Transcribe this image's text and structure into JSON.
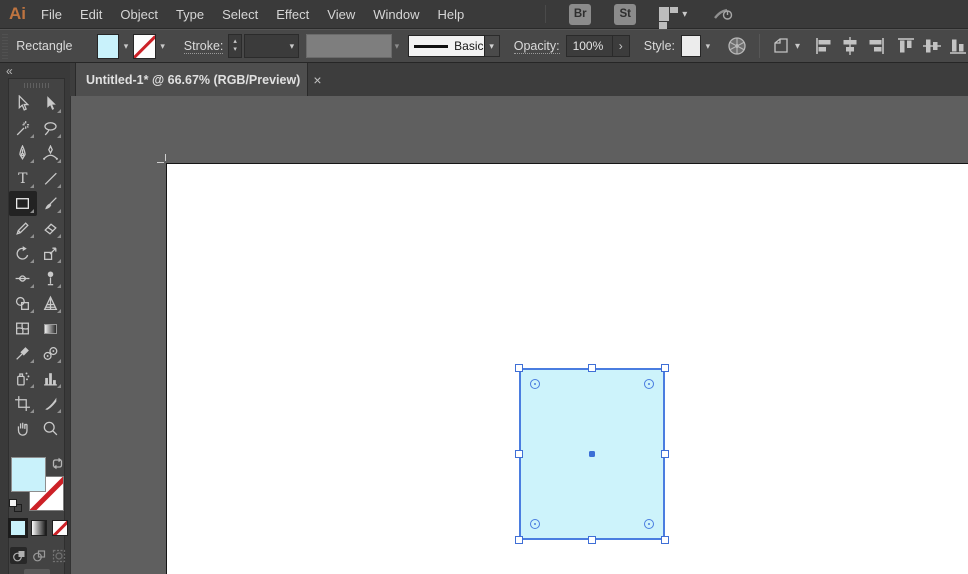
{
  "menu_bar": {
    "logo": "Ai",
    "items": [
      "File",
      "Edit",
      "Object",
      "Type",
      "Select",
      "Effect",
      "View",
      "Window",
      "Help"
    ],
    "bridge_button": "Br",
    "stock_button": "St"
  },
  "control_bar": {
    "context_label": "Rectangle",
    "stroke_label": "Stroke:",
    "brush_name": "Basic",
    "opacity_label": "Opacity:",
    "opacity_value": "100%",
    "style_label": "Style:"
  },
  "document_tab": {
    "title": "Untitled-1* @ 66.67% (RGB/Preview)",
    "close_label": "×"
  },
  "toolbar": {
    "collapse_label": "«",
    "tools": [
      {
        "name": "selection-tool"
      },
      {
        "name": "direct-selection-tool"
      },
      {
        "name": "magic-wand-tool"
      },
      {
        "name": "lasso-tool"
      },
      {
        "name": "pen-tool"
      },
      {
        "name": "curvature-tool"
      },
      {
        "name": "type-tool",
        "glyph": "T"
      },
      {
        "name": "line-segment-tool"
      },
      {
        "name": "rectangle-tool",
        "selected": true
      },
      {
        "name": "paintbrush-tool"
      },
      {
        "name": "pencil-tool"
      },
      {
        "name": "eraser-tool"
      },
      {
        "name": "rotate-tool"
      },
      {
        "name": "scale-tool"
      },
      {
        "name": "width-tool"
      },
      {
        "name": "puppet-warp-tool"
      },
      {
        "name": "shape-builder-tool"
      },
      {
        "name": "perspective-grid-tool"
      },
      {
        "name": "mesh-tool"
      },
      {
        "name": "gradient-tool"
      },
      {
        "name": "eyedropper-tool"
      },
      {
        "name": "blend-tool"
      },
      {
        "name": "symbol-sprayer-tool"
      },
      {
        "name": "column-graph-tool"
      },
      {
        "name": "artboard-tool"
      },
      {
        "name": "slice-tool"
      },
      {
        "name": "hand-tool"
      },
      {
        "name": "zoom-tool"
      }
    ],
    "fill_color": "#c9f2fb",
    "stroke_color": "none"
  },
  "canvas": {
    "selection": {
      "shape": "rectangle",
      "fill": "#cdf3fb",
      "stroke_color": "#4a7de0"
    }
  },
  "icons": {
    "chevron_down": "▾",
    "chevron_right": "›",
    "stepper_up": "▴",
    "stepper_down": "▾"
  },
  "colors": {
    "menu_bar_bg": "#3a3a3a",
    "control_bar_bg": "#484848",
    "panel_bg": "#434343",
    "pasteboard": "#5f5f5f",
    "artboard": "#ffffff",
    "selection_blue": "#4a7de0",
    "fill_cyan": "#c9f2fb",
    "logo_orange": "#bf7440"
  }
}
